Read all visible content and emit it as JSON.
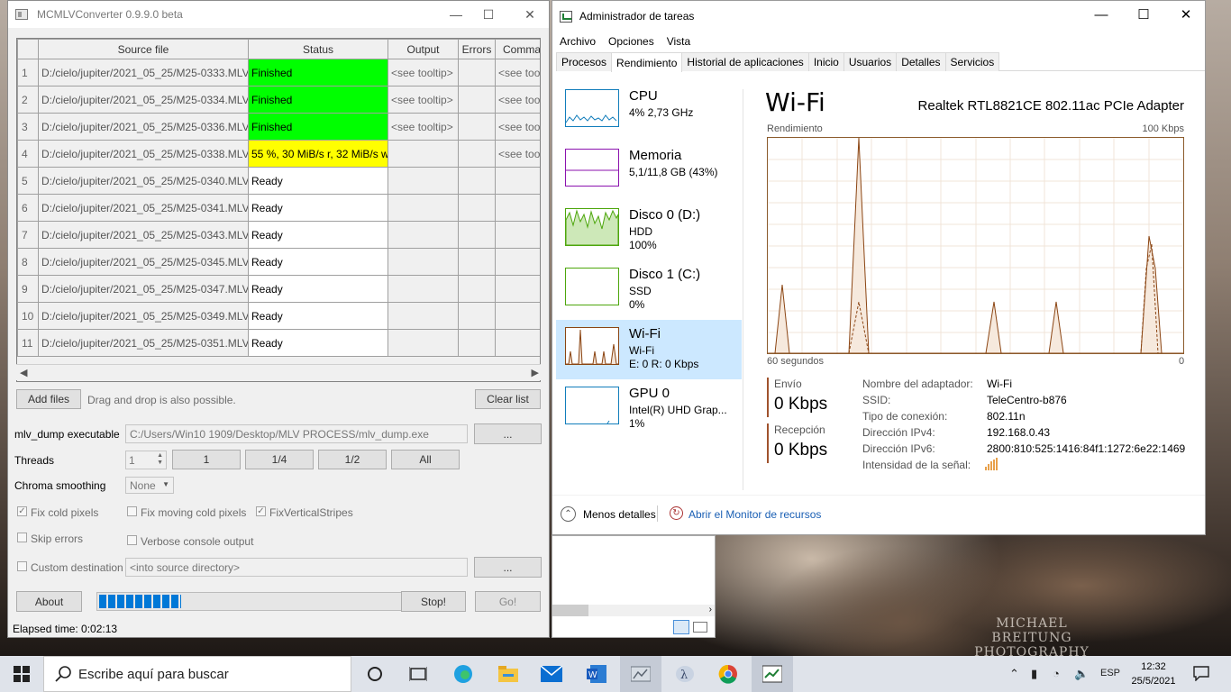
{
  "desktop": {
    "watermark_line1": "MICHAEL BREITUNG",
    "watermark_line2": "PHOTOGRAPHY"
  },
  "mcmlv": {
    "title": "MCMLVConverter 0.9.9.0 beta",
    "columns": [
      "",
      "Source file",
      "Status",
      "Output",
      "Errors",
      "Commar"
    ],
    "rows": [
      {
        "n": "1",
        "src": "D:/cielo/jupiter/2021_05_25/M25-0333.MLV",
        "status": "Finished",
        "out": "<see tooltip>",
        "err": "",
        "cmd": "<see tool",
        "state": "done"
      },
      {
        "n": "2",
        "src": "D:/cielo/jupiter/2021_05_25/M25-0334.MLV",
        "status": "Finished",
        "out": "<see tooltip>",
        "err": "",
        "cmd": "<see tool",
        "state": "done"
      },
      {
        "n": "3",
        "src": "D:/cielo/jupiter/2021_05_25/M25-0336.MLV",
        "status": "Finished",
        "out": "<see tooltip>",
        "err": "",
        "cmd": "<see tool",
        "state": "done"
      },
      {
        "n": "4",
        "src": "D:/cielo/jupiter/2021_05_25/M25-0338.MLV",
        "status": "55 %, 30 MiB/s r, 32 MiB/s w",
        "out": "",
        "err": "",
        "cmd": "<see tool",
        "state": "working"
      },
      {
        "n": "5",
        "src": "D:/cielo/jupiter/2021_05_25/M25-0340.MLV",
        "status": "Ready",
        "out": "",
        "err": "",
        "cmd": "",
        "state": "ready"
      },
      {
        "n": "6",
        "src": "D:/cielo/jupiter/2021_05_25/M25-0341.MLV",
        "status": "Ready",
        "out": "",
        "err": "",
        "cmd": "",
        "state": "ready"
      },
      {
        "n": "7",
        "src": "D:/cielo/jupiter/2021_05_25/M25-0343.MLV",
        "status": "Ready",
        "out": "",
        "err": "",
        "cmd": "",
        "state": "ready"
      },
      {
        "n": "8",
        "src": "D:/cielo/jupiter/2021_05_25/M25-0345.MLV",
        "status": "Ready",
        "out": "",
        "err": "",
        "cmd": "",
        "state": "ready"
      },
      {
        "n": "9",
        "src": "D:/cielo/jupiter/2021_05_25/M25-0347.MLV",
        "status": "Ready",
        "out": "",
        "err": "",
        "cmd": "",
        "state": "ready"
      },
      {
        "n": "10",
        "src": "D:/cielo/jupiter/2021_05_25/M25-0349.MLV",
        "status": "Ready",
        "out": "",
        "err": "",
        "cmd": "",
        "state": "ready"
      },
      {
        "n": "11",
        "src": "D:/cielo/jupiter/2021_05_25/M25-0351.MLV",
        "status": "Ready",
        "out": "",
        "err": "",
        "cmd": "",
        "state": "ready"
      }
    ],
    "status_colors": {
      "done": "#00ff00",
      "working": "#ffff00",
      "ready": "#ffffff"
    },
    "add_files": "Add files",
    "drag_hint": "Drag and drop is also possible.",
    "clear_list": "Clear list",
    "mlv_dump_label": "mlv_dump executable",
    "mlv_dump_path": "C:/Users/Win10 1909/Desktop/MLV PROCESS/mlv_dump.exe",
    "browse": "...",
    "threads_label": "Threads",
    "threads_value": "1",
    "thread_buttons": [
      "1",
      "1/4",
      "1/2",
      "All"
    ],
    "chroma_label": "Chroma smoothing",
    "chroma_value": "None",
    "fix_cold": "Fix cold pixels",
    "fix_moving": "Fix moving cold pixels",
    "fix_vertical": "FixVerticalStripes",
    "skip_errors": "Skip errors",
    "verbose": "Verbose console output",
    "custom_dest": "Custom destination",
    "dest_placeholder": "<into source directory>",
    "about": "About",
    "stop": "Stop!",
    "go": "Go!",
    "progress": 0.27,
    "elapsed": "Elapsed time: 0:02:13"
  },
  "taskmgr": {
    "title": "Administrador de tareas",
    "menu": [
      "Archivo",
      "Opciones",
      "Vista"
    ],
    "tabs": [
      "Procesos",
      "Rendimiento",
      "Historial de aplicaciones",
      "Inicio",
      "Usuarios",
      "Detalles",
      "Servicios"
    ],
    "active_tab": "Rendimiento",
    "side": [
      {
        "name": "CPU",
        "l2": "4% 2,73 GHz",
        "l3": ""
      },
      {
        "name": "Memoria",
        "l2": "5,1/11,8 GB (43%)",
        "l3": ""
      },
      {
        "name": "Disco 0 (D:)",
        "l2": "HDD",
        "l3": "100%"
      },
      {
        "name": "Disco 1 (C:)",
        "l2": "SSD",
        "l3": "0%"
      },
      {
        "name": "Wi-Fi",
        "l2": "Wi-Fi",
        "l3": "E: 0 R: 0 Kbps"
      },
      {
        "name": "GPU 0",
        "l2": "Intel(R) UHD Grap...",
        "l3": "1%"
      }
    ],
    "heading": "Wi-Fi",
    "adapter": "Realtek RTL8821CE 802.11ac PCIe Adapter",
    "perf_label": "Rendimiento",
    "max_label": "100 Kbps",
    "time_left": "60 segundos",
    "time_right": "0",
    "send_label": "Envío",
    "send_value": "0 Kbps",
    "recv_label": "Recepción",
    "recv_value": "0 Kbps",
    "props": [
      {
        "k": "Nombre del adaptador:",
        "v": "Wi-Fi"
      },
      {
        "k": "SSID:",
        "v": "TeleCentro-b876"
      },
      {
        "k": "Tipo de conexión:",
        "v": "802.11n"
      },
      {
        "k": "Dirección IPv4:",
        "v": "192.168.0.43"
      },
      {
        "k": "Dirección IPv6:",
        "v": "2800:810:525:1416:84f1:1272:6e22:1469"
      },
      {
        "k": "Intensidad de la señal:",
        "v": ""
      }
    ],
    "less_details": "Menos detalles",
    "resource_monitor": "Abrir el Monitor de recursos",
    "graph_color": "#8b4513"
  },
  "taskbar": {
    "search_placeholder": "Escribe aquí para buscar",
    "lang": "ESP",
    "time": "12:32",
    "date": "25/5/2021"
  }
}
